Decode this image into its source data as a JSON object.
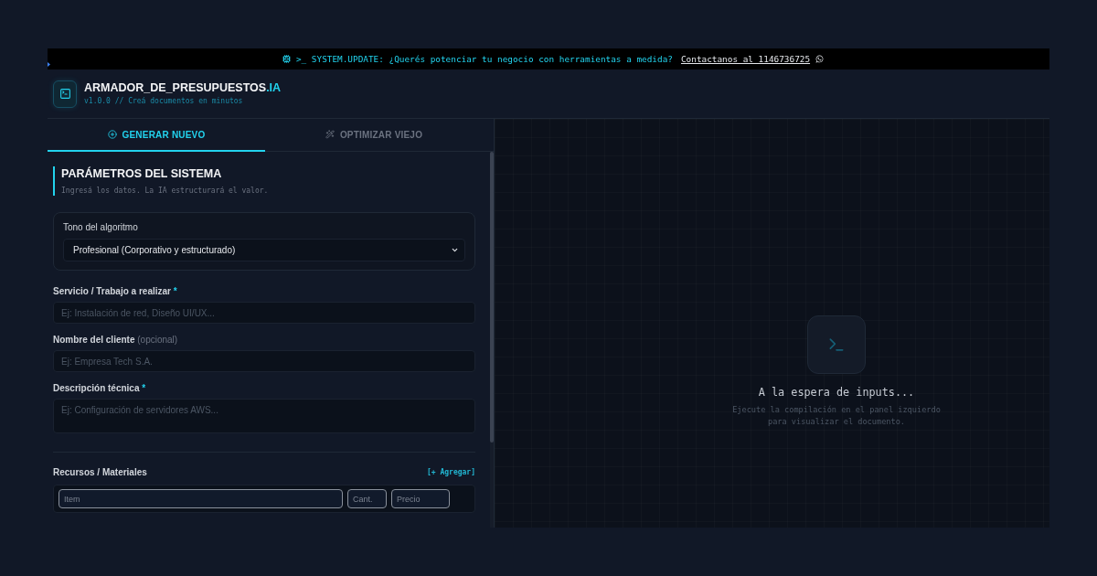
{
  "banner": {
    "text": ">_ SYSTEM.UPDATE: ¿Querés potenciar tu negocio con herramientas a medida?",
    "link": "Contactanos al 1146736725"
  },
  "header": {
    "title": "ARMADOR_DE_PRESUPUESTOS",
    "title_suffix": ".IA",
    "subtitle": "v1.0.0 // Creá documentos en minutos"
  },
  "tabs": [
    {
      "label": "GENERAR NUEVO",
      "selected": true
    },
    {
      "label": "OPTIMIZAR VIEJO",
      "selected": false
    }
  ],
  "section": {
    "title": "PARÁMETROS DEL SISTEMA",
    "subtitle": "Ingresá los datos. La IA estructurará el valor."
  },
  "tone": {
    "label": "Tono del algoritmo",
    "value": "Profesional (Corporativo y estructurado)"
  },
  "fields": [
    {
      "kind": "input",
      "label": "Servicio / Trabajo a realizar",
      "required_mark": "*",
      "placeholder": "Ej: Instalación de red, Diseño UI/UX..."
    },
    {
      "kind": "input",
      "label": "Nombre del cliente",
      "note": "(opcional)",
      "placeholder": "Ej: Empresa Tech S.A."
    },
    {
      "kind": "textarea",
      "label": "Descripción técnica",
      "required_mark": "*",
      "placeholder": "Ej: Configuración de servidores AWS..."
    }
  ],
  "resources": {
    "label": "Recursos / Materiales",
    "add_button": "[+ Agregar]",
    "rows": [
      {
        "item_placeholder": "Item",
        "qty_placeholder": "Cant.",
        "price_placeholder": "Precio"
      }
    ]
  },
  "preview": {
    "title": "A la espera de inputs...",
    "message": "Ejecute la compilación en el panel izquierdo para visualizar el documento."
  }
}
